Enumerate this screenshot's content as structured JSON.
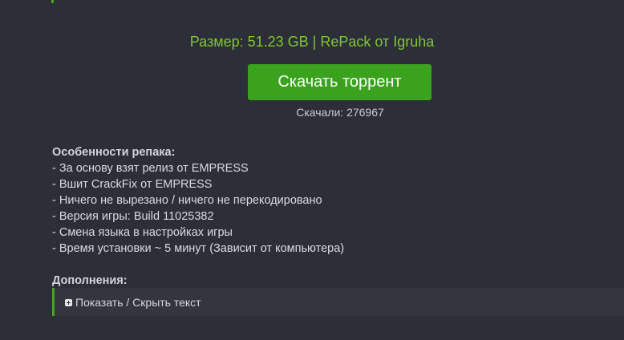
{
  "size_info": "Размер: 51.23 GB | RePack от Igruha",
  "download_button": "Скачать торрент",
  "downloads_count": "Скачали: 276967",
  "features": {
    "title": "Особенности репака:",
    "items": [
      "- За основу взят релиз от EMPRESS",
      "- Вшит CrackFix от EMPRESS",
      "- Ничего не вырезано / ничего не перекодировано",
      "- Версия игры: Build 11025382",
      "- Смена языка в настройках игры",
      "- Время установки ~ 5 минут (Зависит от компьютера)"
    ]
  },
  "extras": {
    "title": "Дополнения:",
    "toggle_label": "Показать / Скрыть текст",
    "toggle_icon": "plus-icon"
  },
  "colors": {
    "background": "#2c2f37",
    "accent_green": "#3aa21c",
    "size_text": "#84c43a"
  }
}
